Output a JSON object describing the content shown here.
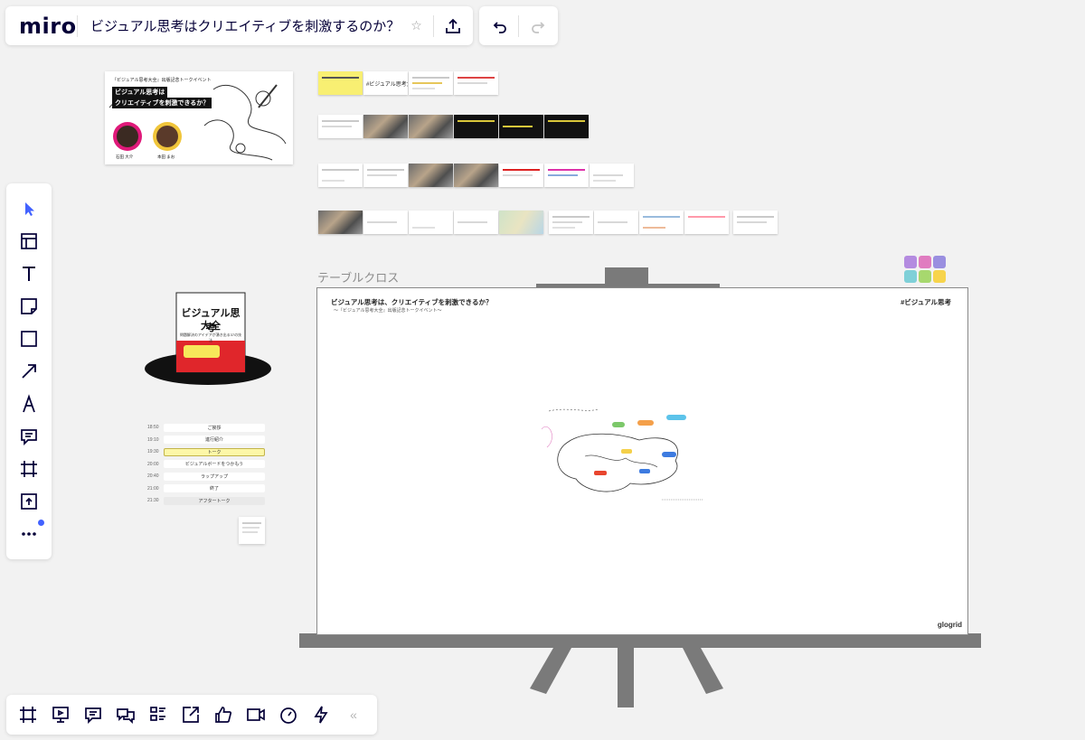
{
  "app": {
    "logo": "miro",
    "board_title": "ビジュアル思考はクリエイティブを刺激するのか？",
    "star_glyph": "☆",
    "collapse_glyph": "«"
  },
  "top_toolbar": {
    "icons": [
      "share-upload-icon",
      "undo-icon",
      "redo-icon"
    ]
  },
  "left_toolbar": {
    "tools": [
      "select-cursor-icon",
      "templates-icon",
      "text-icon",
      "sticky-note-icon",
      "shape-icon",
      "arrow-icon",
      "pen-icon",
      "comment-icon",
      "frame-icon",
      "upload-icon",
      "more-icon"
    ]
  },
  "bottom_toolbar": {
    "tools": [
      "frames-icon",
      "presentation-icon",
      "comments-icon",
      "chat-icon",
      "card-list-icon",
      "screen-share-icon",
      "voting-icon",
      "video-chat-icon",
      "timer-icon",
      "activity-icon"
    ]
  },
  "canvas": {
    "event_banner": {
      "line1": "『ビジュアル思考大全』出版記念トークイベント",
      "line2": "ビジュアル思考は",
      "line3": "クリエイティブを刺激できるか？",
      "speaker1": "石田 大介",
      "speaker2": "本田 まお"
    },
    "thumb_tag_label": "#ビジュアル思考大全",
    "easel_label": "テーブルクロス",
    "whiteboard": {
      "title": "ビジュアル思考は、クリエイティブを刺激できるか？",
      "subtitle": "～『ビジュアル思考大全』出版記念トークイベント～",
      "hashtag": "#ビジュアル思考",
      "logo": "glogrid"
    },
    "book": {
      "title_line1": "ビジュアル思考",
      "title_line2": "大全",
      "subtitle": "問題解決のアイデアが湧き出る37の技法"
    },
    "schedule": [
      {
        "time": "18:50",
        "item": "ご挨拶",
        "state": "normal"
      },
      {
        "time": "19:10",
        "item": "進行紹介",
        "state": "normal"
      },
      {
        "time": "19:30",
        "item": "トーク",
        "state": "active"
      },
      {
        "time": "20:00",
        "item": "ビジュアルボードをつかもう",
        "state": "normal"
      },
      {
        "time": "20:40",
        "item": "ラップアップ",
        "state": "normal"
      },
      {
        "time": "21:00",
        "item": "終了",
        "state": "normal"
      },
      {
        "time": "21:30",
        "item": "アフタートーク",
        "state": "grey"
      }
    ]
  },
  "colors": {
    "accent": "#4262ff",
    "canvas_bg": "#f2f2f2",
    "easel_gray": "#7a7a7a",
    "ink": "#050038"
  }
}
